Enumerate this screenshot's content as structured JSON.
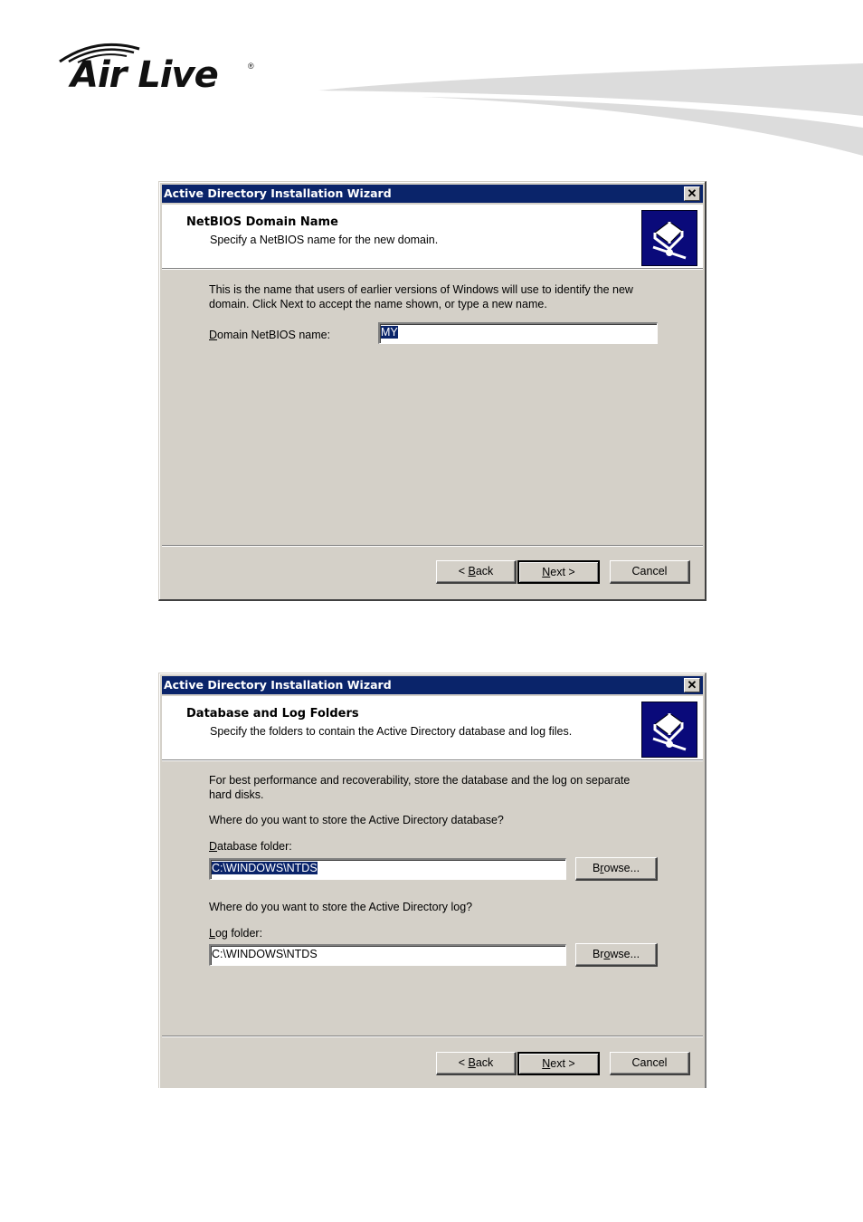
{
  "brand": {
    "name": "Air Live",
    "registered_mark": "®"
  },
  "dialogs": [
    {
      "title": "Active Directory Installation Wizard",
      "close_glyph": "✕",
      "header_title": "NetBIOS Domain Name",
      "header_subtitle": "Specify a NetBIOS name for the new domain.",
      "description_line1": "This is the name that users of earlier versions of Windows will use to identify the new",
      "description_line2": "domain. Click Next to accept the name shown, or type a new name.",
      "field_label_accel": "D",
      "field_label_rest": "omain NetBIOS name:",
      "field_value": "MY",
      "buttons": {
        "back_prefix": "< ",
        "back_accel": "B",
        "back_rest": "ack",
        "next_accel": "N",
        "next_rest": "ext >",
        "cancel": "Cancel"
      }
    },
    {
      "title": "Active Directory Installation Wizard",
      "close_glyph": "✕",
      "header_title": "Database and Log Folders",
      "header_subtitle": "Specify the folders to contain the Active Directory database and log files.",
      "description_line1": "For best performance and recoverability, store the database and the log on separate",
      "description_line2": "hard disks.",
      "db_question": "Where do you want to store the Active Directory database?",
      "db_label_accel": "D",
      "db_label_rest": "atabase folder:",
      "db_value": "C:\\WINDOWS\\NTDS",
      "log_question": "Where do you want to store the Active Directory log?",
      "log_label_accel": "L",
      "log_label_rest": "og folder:",
      "log_value": "C:\\WINDOWS\\NTDS",
      "browse_pre": "B",
      "browse_accel": "r",
      "browse_post": "owse...",
      "browse2_pre": "Br",
      "browse2_accel": "o",
      "browse2_post": "wse...",
      "buttons": {
        "back_prefix": "< ",
        "back_accel": "B",
        "back_rest": "ack",
        "next_accel": "N",
        "next_rest": "ext >",
        "cancel": "Cancel"
      }
    }
  ]
}
